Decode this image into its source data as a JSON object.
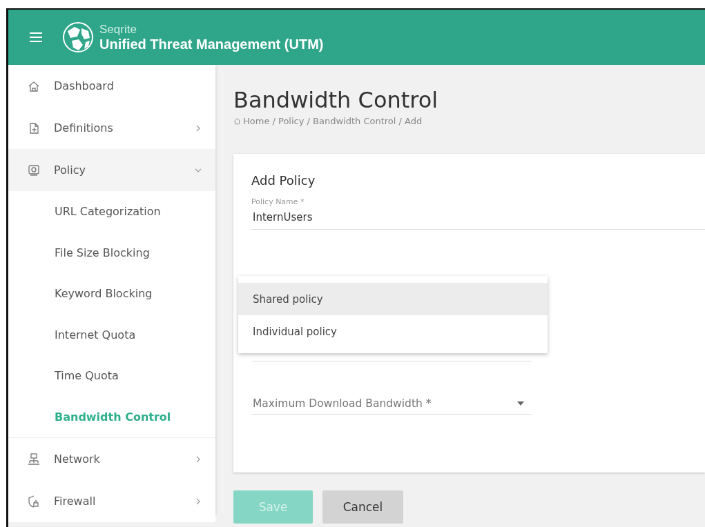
{
  "header": {
    "brand": "Seqrite",
    "title": "Unified Threat Management (UTM)"
  },
  "sidebar": {
    "items": [
      {
        "label": "Dashboard",
        "has_arrow": false,
        "expanded": false
      },
      {
        "label": "Definitions",
        "has_arrow": true,
        "expanded": false
      },
      {
        "label": "Policy",
        "has_arrow": true,
        "expanded": true,
        "children": [
          {
            "label": "URL Categorization",
            "selected": false
          },
          {
            "label": "File Size Blocking",
            "selected": false
          },
          {
            "label": "Keyword Blocking",
            "selected": false
          },
          {
            "label": "Internet Quota",
            "selected": false
          },
          {
            "label": "Time Quota",
            "selected": false
          },
          {
            "label": "Bandwidth Control",
            "selected": true
          }
        ]
      },
      {
        "label": "Network",
        "has_arrow": true,
        "expanded": false
      },
      {
        "label": "Firewall",
        "has_arrow": true,
        "expanded": false
      }
    ]
  },
  "page": {
    "title": "Bandwidth Control",
    "breadcrumb": "Home / Policy / Bandwidth Control / Add"
  },
  "form": {
    "title": "Add Policy",
    "policy_name": {
      "label": "Policy Name *",
      "value": "InternUsers"
    },
    "menu": [
      {
        "label": "Shared policy",
        "selected": true
      },
      {
        "label": "Individual policy",
        "selected": false
      }
    ],
    "download": {
      "placeholder": "Maximum Download Bandwidth *"
    }
  },
  "buttons": [
    {
      "label": "Save",
      "kind": "primary",
      "disabled": true
    },
    {
      "label": "Cancel",
      "kind": "secondary",
      "disabled": false
    }
  ]
}
